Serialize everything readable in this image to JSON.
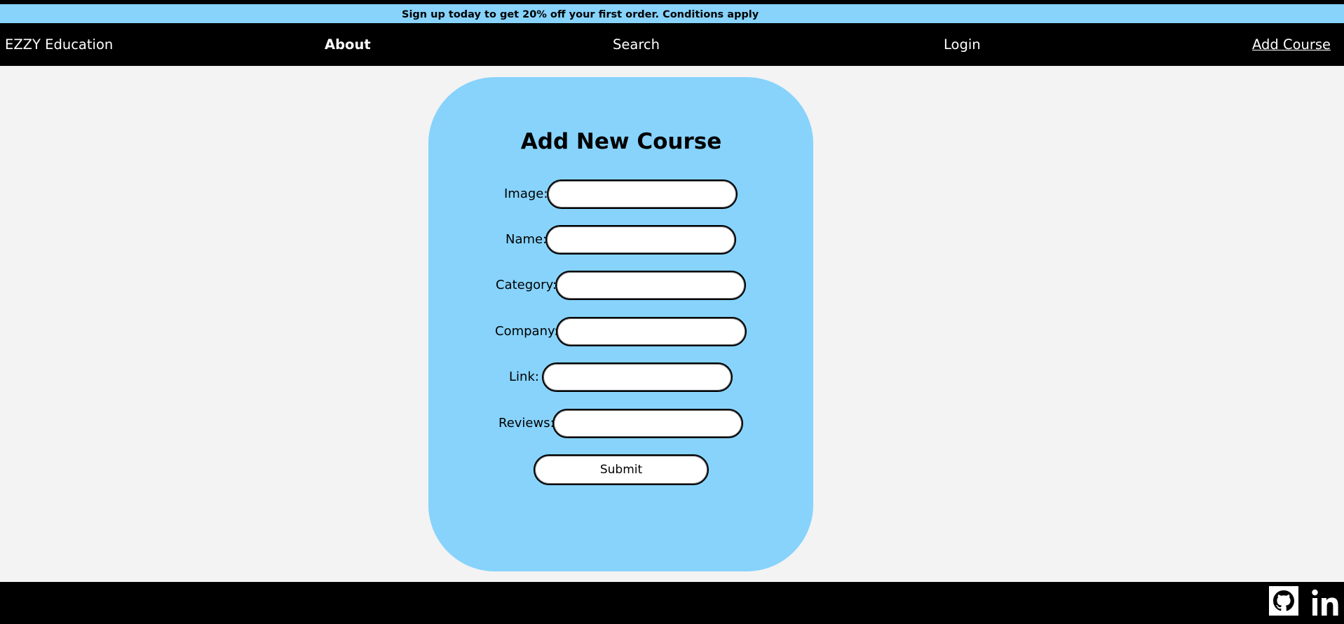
{
  "promo": {
    "text": "Sign up today to get 20% off your first order. Conditions apply"
  },
  "nav": {
    "brand": "EZZY Education",
    "about": "About",
    "search": "Search",
    "login": "Login",
    "add_course": "Add Course"
  },
  "form": {
    "title": "Add New Course",
    "fields": [
      {
        "label": "Image:",
        "value": ""
      },
      {
        "label": "Name:",
        "value": ""
      },
      {
        "label": "Category:",
        "value": ""
      },
      {
        "label": "Company:",
        "value": ""
      },
      {
        "label": "Link:",
        "value": ""
      },
      {
        "label": "Reviews:",
        "value": ""
      }
    ],
    "submit_label": "Submit"
  },
  "footer": {
    "icons": [
      "github-icon",
      "linkedin-icon"
    ]
  },
  "colors": {
    "promo_bg": "#87d3fc",
    "nav_bg": "#000000",
    "card_bg": "#87d3fc",
    "page_bg": "#f3f3f3"
  }
}
